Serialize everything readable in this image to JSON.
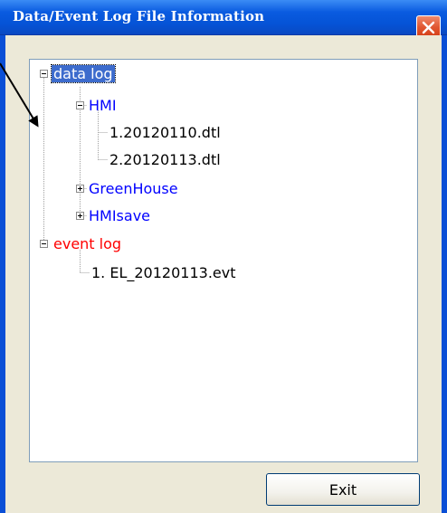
{
  "window": {
    "title": "Data/Event Log File Information"
  },
  "tree": {
    "data_log": {
      "label": "data log",
      "children": {
        "hmi": {
          "label": "HMI",
          "files": [
            "1.20120110.dtl",
            "2.20120113.dtl"
          ]
        },
        "greenhouse": {
          "label": "GreenHouse"
        },
        "hmisave": {
          "label": "HMIsave"
        }
      }
    },
    "event_log": {
      "label": "event log",
      "files": [
        "1. EL_20120113.evt"
      ]
    }
  },
  "buttons": {
    "exit_label": "Exit"
  },
  "colors": {
    "folder_blue": "#0000ff",
    "event_red": "#ff0000",
    "selection": "#3d6ccd",
    "title_bar": "#0553d6"
  }
}
